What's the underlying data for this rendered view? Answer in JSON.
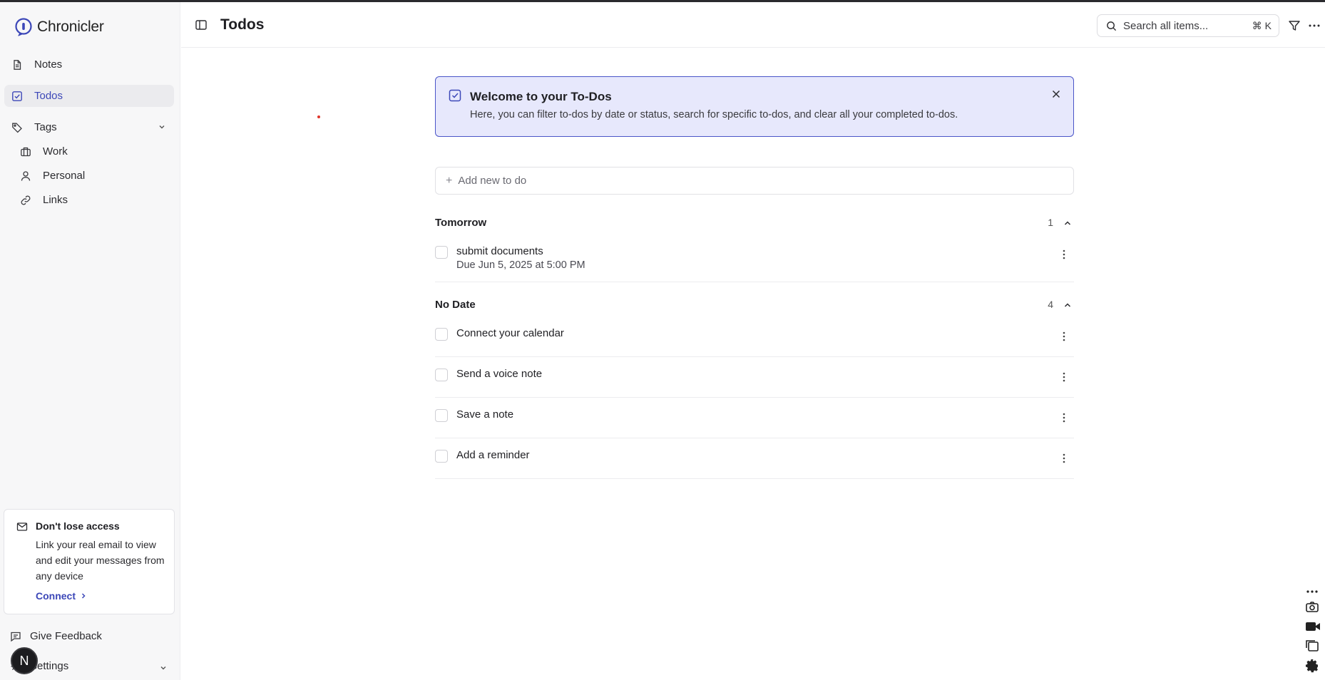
{
  "app": {
    "name": "Chronicler",
    "accent": "#3c47b8"
  },
  "sidebar": {
    "items": [
      {
        "label": "Notes",
        "icon": "document-icon"
      },
      {
        "label": "Todos",
        "icon": "checkbox-icon",
        "active": true
      },
      {
        "label": "Tags",
        "icon": "tag-icon"
      }
    ],
    "tags": [
      {
        "label": "Work",
        "icon": "briefcase-icon"
      },
      {
        "label": "Personal",
        "icon": "user-icon"
      },
      {
        "label": "Links",
        "icon": "link-icon"
      }
    ],
    "promo": {
      "title": "Don't lose access",
      "body": "Link your real email to view and edit your messages from any device",
      "link": "Connect"
    },
    "feedback": "Give Feedback",
    "settings": "Settings",
    "avatar_initial": "N"
  },
  "header": {
    "title": "Todos",
    "search_placeholder": "Search all items...",
    "search_shortcut": "⌘ K"
  },
  "welcome": {
    "title": "Welcome to your To-Dos",
    "body": "Here, you can filter to-dos by date or status, search for specific to-dos, and clear all your completed to-dos."
  },
  "add_todo_placeholder": "Add new to do",
  "sections": [
    {
      "label": "Tomorrow",
      "count": "1",
      "todos": [
        {
          "title": "submit documents",
          "due": "Due Jun 5, 2025 at 5:00 PM"
        }
      ]
    },
    {
      "label": "No Date",
      "count": "4",
      "todos": [
        {
          "title": "Connect your calendar"
        },
        {
          "title": "Send a voice note"
        },
        {
          "title": "Save a note"
        },
        {
          "title": "Add a reminder"
        }
      ]
    }
  ]
}
